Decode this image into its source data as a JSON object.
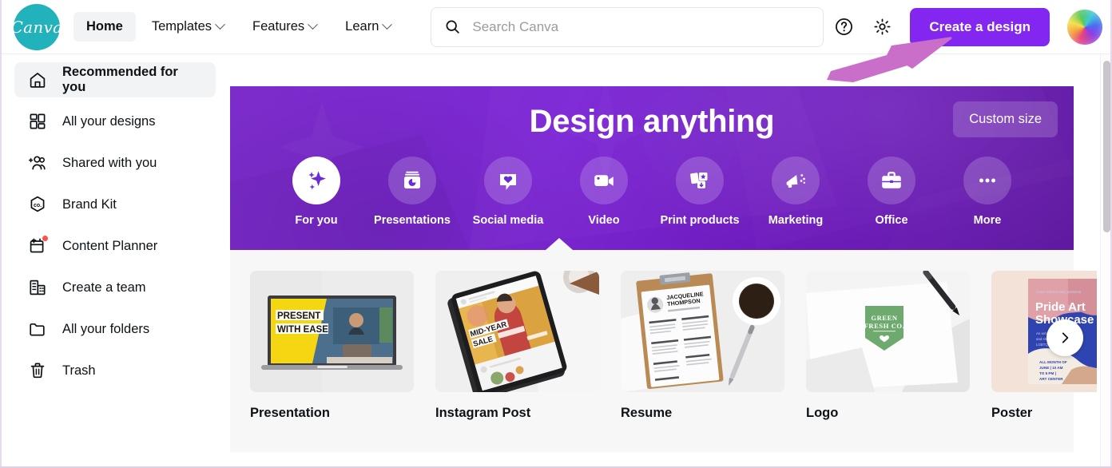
{
  "header": {
    "logo_text": "Canva",
    "nav": [
      {
        "label": "Home",
        "has_caret": false,
        "active": true
      },
      {
        "label": "Templates",
        "has_caret": true,
        "active": false
      },
      {
        "label": "Features",
        "has_caret": true,
        "active": false
      },
      {
        "label": "Learn",
        "has_caret": true,
        "active": false
      }
    ],
    "search": {
      "placeholder": "Search Canva",
      "value": "",
      "icon": "search-icon"
    },
    "help_icon": "question-circle-icon",
    "settings_icon": "gear-icon",
    "create_button": "Create a design",
    "avatar_alt": "user-avatar"
  },
  "annotation": {
    "type": "arrow",
    "color": "#c76cc8",
    "points_to": "Create a design"
  },
  "sidebar": {
    "items": [
      {
        "label": "Recommended for you",
        "icon": "home-icon",
        "active": true,
        "badge": false
      },
      {
        "label": "All your designs",
        "icon": "grid-icon",
        "active": false,
        "badge": false
      },
      {
        "label": "Shared with you",
        "icon": "add-people-icon",
        "active": false,
        "badge": false
      },
      {
        "label": "Brand Kit",
        "icon": "brand-hexagon-icon",
        "active": false,
        "badge": false
      },
      {
        "label": "Content Planner",
        "icon": "calendar-plus-icon",
        "active": false,
        "badge": true
      },
      {
        "label": "Create a team",
        "icon": "building-icon",
        "active": false,
        "badge": false
      },
      {
        "label": "All your folders",
        "icon": "folder-icon",
        "active": false,
        "badge": false
      },
      {
        "label": "Trash",
        "icon": "trash-icon",
        "active": false,
        "badge": false
      }
    ]
  },
  "banner": {
    "title": "Design anything",
    "custom_size_button": "Custom size",
    "background_color": "#7327cc",
    "categories": [
      {
        "label": "For you",
        "icon": "sparkle-icon",
        "active": true
      },
      {
        "label": "Presentations",
        "icon": "presentation-chart-icon",
        "active": false
      },
      {
        "label": "Social media",
        "icon": "heart-bubble-icon",
        "active": false
      },
      {
        "label": "Video",
        "icon": "video-camera-icon",
        "active": false
      },
      {
        "label": "Print products",
        "icon": "print-cards-icon",
        "active": false
      },
      {
        "label": "Marketing",
        "icon": "megaphone-icon",
        "active": false
      },
      {
        "label": "Office",
        "icon": "briefcase-icon",
        "active": false
      },
      {
        "label": "More",
        "icon": "ellipsis-icon",
        "active": false
      }
    ]
  },
  "templates": {
    "next_arrow_icon": "chevron-right-icon",
    "cards": [
      {
        "label": "Presentation",
        "thumb": "laptop-present-with-ease",
        "thumb_text": "PRESENT WITH EASE"
      },
      {
        "label": "Instagram Post",
        "thumb": "phone-mid-year-sale",
        "thumb_text": "MID-YEAR SALE"
      },
      {
        "label": "Resume",
        "thumb": "clipboard-resume",
        "thumb_text": "JACQUELINE THOMPSON"
      },
      {
        "label": "Logo",
        "thumb": "green-fresh-co-logo",
        "thumb_text": "GREEN FRESH CO."
      },
      {
        "label": "Poster",
        "thumb": "pride-art-showcase-poster",
        "thumb_text": "Pride Art Showcase"
      }
    ]
  },
  "scrollbar": {
    "orientation": "vertical",
    "position": "right"
  }
}
